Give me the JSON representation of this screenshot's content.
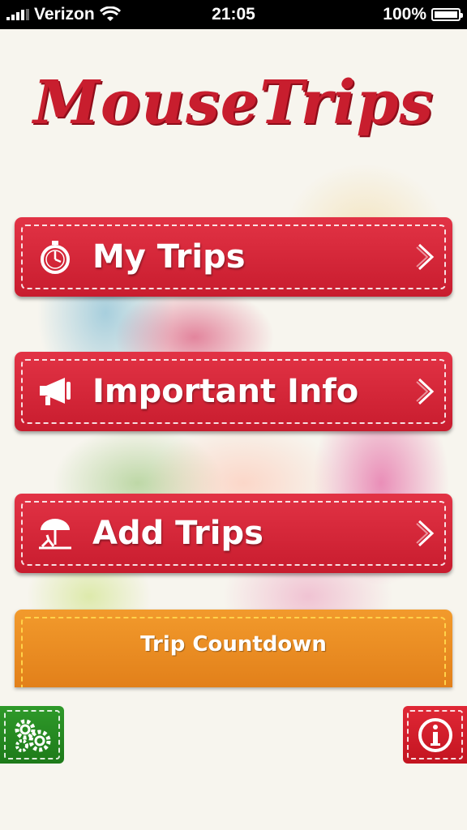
{
  "status_bar": {
    "carrier": "Verizon",
    "time": "21:05",
    "battery": "100%"
  },
  "app": {
    "logo": "MouseTrips"
  },
  "menu": {
    "my_trips": "My Trips",
    "important_info": "Important Info",
    "add_trips": "Add Trips",
    "trip_countdown": "Trip Countdown"
  },
  "icons": {
    "my_trips": "stopwatch-icon",
    "important_info": "megaphone-icon",
    "add_trips": "beach-umbrella-icon",
    "settings": "gears-icon",
    "info": "info-icon",
    "chevron": "chevron-right-icon"
  },
  "colors": {
    "menu_red": "#d42636",
    "countdown_orange": "#ec8c22",
    "settings_green": "#258a20",
    "logo_red": "#c81e2e"
  }
}
